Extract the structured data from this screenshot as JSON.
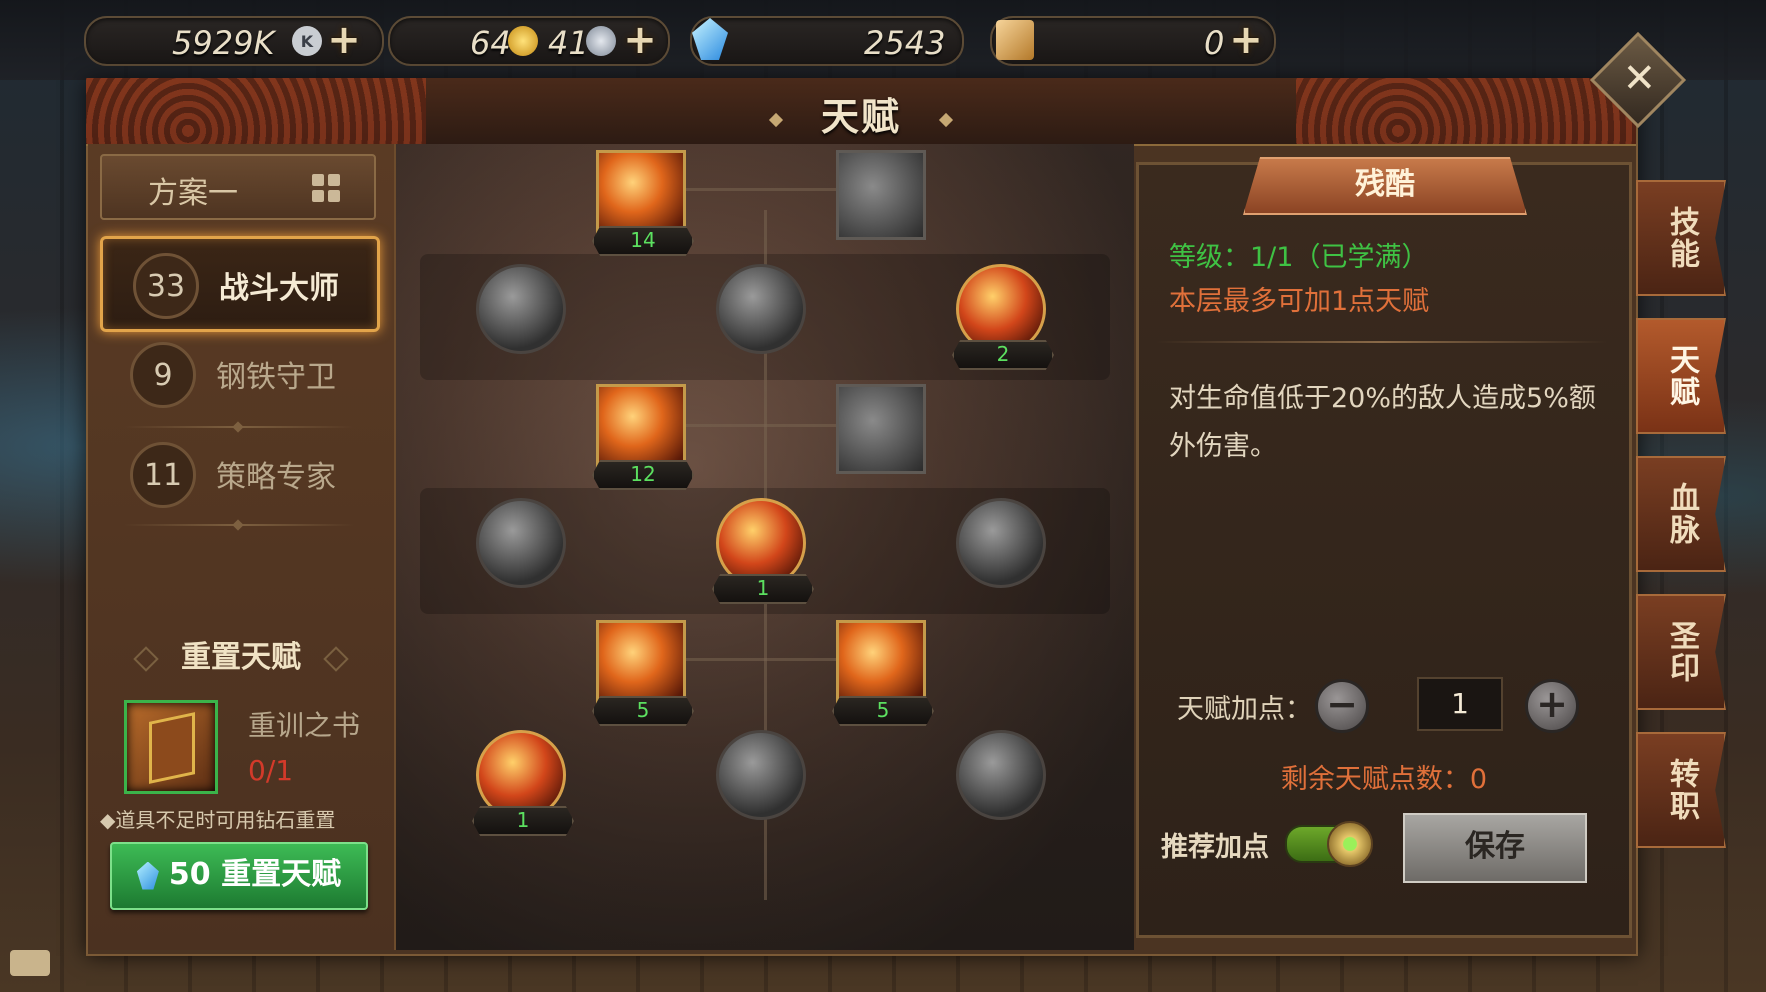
{
  "currency": {
    "silver": {
      "value": "5929K",
      "icon": "silver-coin-icon",
      "coin_letter": "K"
    },
    "gold": {
      "value1": "64",
      "value2": "41",
      "icon1": "gold-coin-icon",
      "icon2": "silver-medal-icon"
    },
    "diamond": {
      "value": "2543",
      "icon": "diamond-icon"
    },
    "card": {
      "value": "0",
      "icon": "card-icon"
    },
    "plus": "+"
  },
  "window": {
    "title": "天赋",
    "close": "✕"
  },
  "left": {
    "scheme_label": "方案一",
    "specs": [
      {
        "points": "33",
        "name": "战斗大师",
        "active": true
      },
      {
        "points": "9",
        "name": "钢铁守卫",
        "active": false
      },
      {
        "points": "11",
        "name": "策略专家",
        "active": false
      }
    ],
    "reset_title": "重置天赋",
    "book_name": "重训之书",
    "book_count": "0/1",
    "hint": "◆道具不足时可用钻石重置",
    "reset_button": "50 重置天赋"
  },
  "tree": {
    "nodes": [
      {
        "id": "n1",
        "rank": "14",
        "on": true
      },
      {
        "id": "n2",
        "rank": "",
        "on": false
      },
      {
        "id": "n3",
        "rank": "",
        "on": false
      },
      {
        "id": "n4",
        "rank": "",
        "on": false
      },
      {
        "id": "n5",
        "rank": "2",
        "on": true
      },
      {
        "id": "n6",
        "rank": "12",
        "on": true
      },
      {
        "id": "n7",
        "rank": "",
        "on": false
      },
      {
        "id": "n8",
        "rank": "",
        "on": false
      },
      {
        "id": "n9",
        "rank": "1",
        "on": true
      },
      {
        "id": "n10",
        "rank": "",
        "on": false
      },
      {
        "id": "n11",
        "rank": "5",
        "on": true
      },
      {
        "id": "n12",
        "rank": "5",
        "on": true
      },
      {
        "id": "n13",
        "rank": "1",
        "on": true
      },
      {
        "id": "n14",
        "rank": "",
        "on": false
      },
      {
        "id": "n15",
        "rank": "",
        "on": false
      }
    ]
  },
  "detail": {
    "name": "残酷",
    "level": "等级：1/1（已学满）",
    "limit": "本层最多可加1点天赋",
    "description": "对生命值低于20%的敌人造成5%额外伤害。",
    "points_label": "天赋加点：",
    "minus": "−",
    "plus": "+",
    "points_value": "1",
    "remaining": "剩余天赋点数：0",
    "recommend_label": "推荐加点",
    "save_button": "保存"
  },
  "sidetabs": [
    {
      "label": "技能",
      "active": false
    },
    {
      "label": "天赋",
      "active": true
    },
    {
      "label": "血脉",
      "active": false
    },
    {
      "label": "圣印",
      "active": false
    },
    {
      "label": "转职",
      "active": false
    }
  ],
  "colors": {
    "accent_gold": "#e2a44a",
    "green": "#3fc244",
    "orange": "#e0703a"
  }
}
